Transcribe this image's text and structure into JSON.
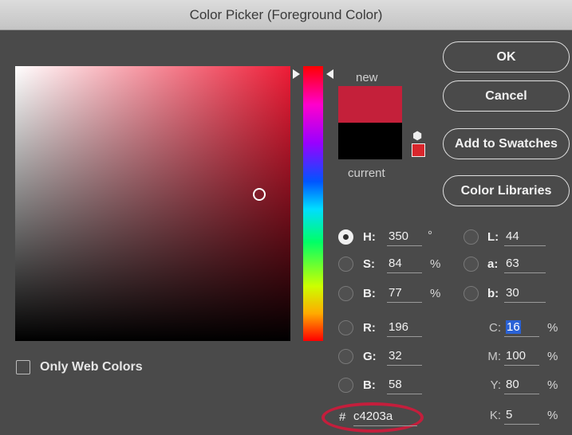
{
  "window": {
    "title": "Color Picker (Foreground Color)"
  },
  "buttons": {
    "ok": "OK",
    "cancel": "Cancel",
    "add_swatches": "Add to Swatches",
    "color_libraries": "Color Libraries"
  },
  "preview": {
    "new_label": "new",
    "current_label": "current",
    "new_color": "#c4203a",
    "current_color": "#000000",
    "gamut_icon": "cube-icon",
    "gamut_color": "#d8262c"
  },
  "only_web_colors": {
    "label": "Only Web Colors",
    "checked": false
  },
  "hsb": {
    "selected": "H",
    "H": {
      "label": "H:",
      "value": "350",
      "unit": "°"
    },
    "S": {
      "label": "S:",
      "value": "84",
      "unit": "%"
    },
    "B": {
      "label": "B:",
      "value": "77",
      "unit": "%"
    }
  },
  "rgb": {
    "R": {
      "label": "R:",
      "value": "196"
    },
    "G": {
      "label": "G:",
      "value": "32"
    },
    "B": {
      "label": "B:",
      "value": "58"
    }
  },
  "lab": {
    "L": {
      "label": "L:",
      "value": "44"
    },
    "a": {
      "label": "a:",
      "value": "63"
    },
    "b": {
      "label": "b:",
      "value": "30"
    }
  },
  "cmyk": {
    "C": {
      "label": "C:",
      "value": "16",
      "unit": "%"
    },
    "M": {
      "label": "M:",
      "value": "100",
      "unit": "%"
    },
    "Y": {
      "label": "Y:",
      "value": "80",
      "unit": "%"
    },
    "K": {
      "label": "K:",
      "value": "5",
      "unit": "%"
    }
  },
  "hex": {
    "label": "#",
    "value": "c4203a",
    "highlight_color": "#c41e3c"
  }
}
